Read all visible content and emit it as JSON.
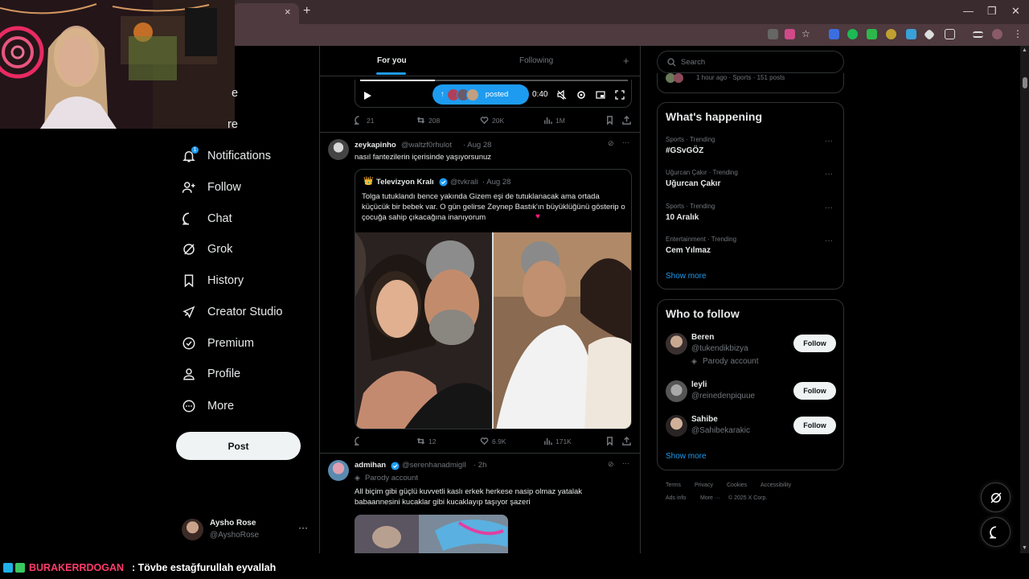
{
  "browser": {
    "close_tab": "×",
    "new_tab": "+",
    "window_minimize": "—",
    "window_maximize": "❐",
    "window_close": "✕"
  },
  "nav": {
    "items": [
      {
        "label": "Notifications",
        "icon": "bell-icon"
      },
      {
        "label": "Follow",
        "icon": "person-plus-icon"
      },
      {
        "label": "Chat",
        "icon": "chat-bubble-icon"
      },
      {
        "label": "Grok",
        "icon": "grok-icon"
      },
      {
        "label": "History",
        "icon": "bookmark-icon"
      },
      {
        "label": "Creator Studio",
        "icon": "rocket-icon"
      },
      {
        "label": "Premium",
        "icon": "verified-icon"
      },
      {
        "label": "Profile",
        "icon": "person-icon"
      },
      {
        "label": "More",
        "icon": "more-circle-icon"
      }
    ],
    "notification_count": "1",
    "post_label": "Post",
    "partial_labels": [
      "e",
      "re"
    ]
  },
  "account": {
    "name": "Aysho Rose",
    "handle": "@AyshoRose",
    "more": "···"
  },
  "feed": {
    "tabs": [
      "For you",
      "Following"
    ],
    "add_tab": "+",
    "video": {
      "time": "0:40"
    },
    "posted_pill": {
      "label": "posted",
      "arrow": "↑"
    },
    "first_post_actions": {
      "replies": "21",
      "reposts": "208",
      "likes": "20K",
      "views": "1M"
    },
    "posts": [
      {
        "name": "zeykapinho",
        "handle": "@waltzf0rhulot",
        "time": "· Aug 28",
        "text": "nasıl fantezilerin içerisinde yaşıyorsunuz",
        "quote": {
          "name": "Televizyon Kralı",
          "handle": "@tvkrali",
          "time": "· Aug 28",
          "text": "Tolga tutuklandı bence yakında Gizem eşi de tutuklanacak ama ortada küçücük bir bebek var. O gün gelirse Zeynep Bastık'ın büyüklüğünü gösterip o çocuğa sahip çıkacağına inanıyorum"
        },
        "actions": {
          "replies": "",
          "reposts": "12",
          "likes": "6.9K",
          "views": "171K"
        }
      },
      {
        "name": "admihan",
        "handle": "@serenhanadmiglI",
        "time": "· 2h",
        "badge": "Parody account",
        "text": "All biçim gibi güçlü kuvvetli kaslı erkek herkese nasip olmaz yatalak babaannesini kucaklar gibi kucaklayıp taşıyor şazeri"
      }
    ]
  },
  "search": {
    "placeholder": "Search"
  },
  "trending_header_meta": "1 hour ago · Sports · 151 posts",
  "whats_happening": {
    "title": "What's happening",
    "trends": [
      {
        "meta": "Sports · Trending",
        "name": "#GSvGÖZ"
      },
      {
        "meta": "Uğurcan Çakır · Trending",
        "name": "Uğurcan Çakır"
      },
      {
        "meta": "Sports · Trending",
        "name": "10 Aralık"
      },
      {
        "meta": "Entertainment · Trending",
        "name": "Cem Yılmaz"
      }
    ],
    "show_more": "Show more",
    "more_dots": "···"
  },
  "who_to_follow": {
    "title": "Who to follow",
    "users": [
      {
        "name": "Beren",
        "handle": "@tukendikbizya",
        "badge": "Parody account"
      },
      {
        "name": "leyli",
        "handle": "@reinedenpiquue"
      },
      {
        "name": "Sahibe",
        "handle": "@Sahibekarakic"
      }
    ],
    "follow_label": "Follow",
    "show_more": "Show more"
  },
  "footer": {
    "links": [
      "Terms",
      "Privacy",
      "Cookies",
      "Accessibility",
      "Ads info",
      "More ···",
      "© 2025 X Corp."
    ]
  },
  "chat": {
    "user": "BURAKERRDOGAN",
    "message": ": Tövbe estağfurullah eyvallah"
  },
  "colors": {
    "accent": "#1d9bf0",
    "background": "#000000",
    "border": "#2f3336",
    "muted": "#71767b"
  }
}
